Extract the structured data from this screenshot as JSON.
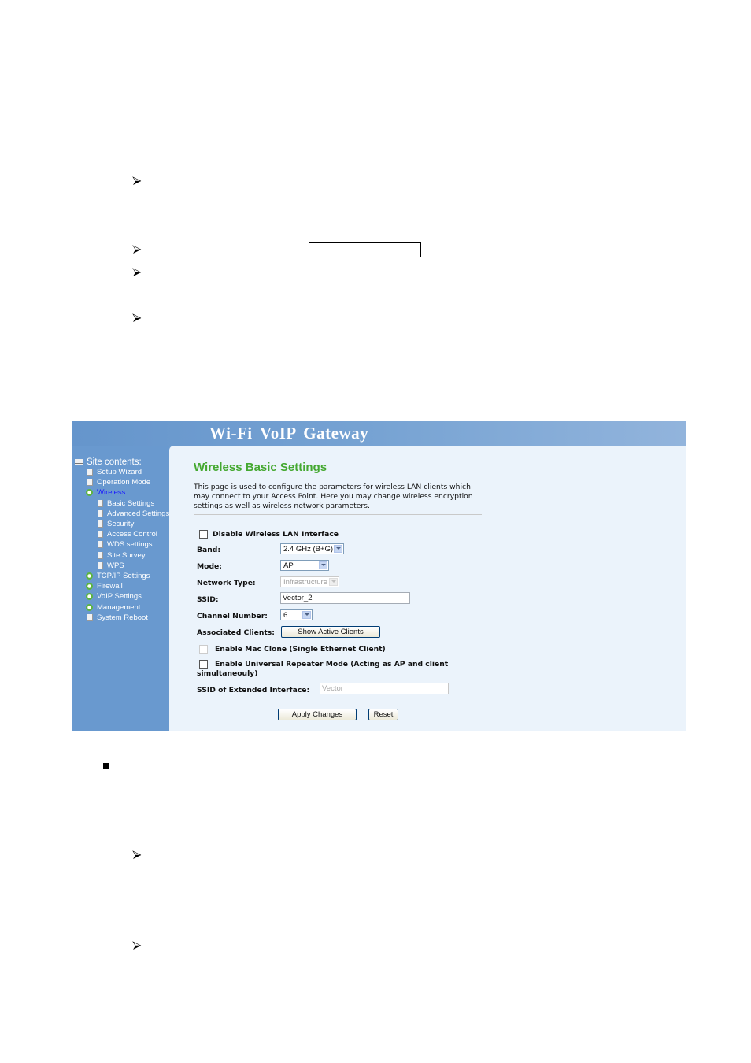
{
  "document": {
    "arrow_bullets": 6,
    "square_bullets": 1,
    "inline_box_text": ""
  },
  "app": {
    "banner_title": "Wi-Fi  VoIP  Gateway"
  },
  "sidebar": {
    "heading": "Site contents:",
    "items": [
      {
        "label": "Setup Wizard",
        "icon": "page-icon",
        "level": 0
      },
      {
        "label": "Operation Mode",
        "icon": "page-icon",
        "level": 0
      },
      {
        "label": "Wireless",
        "icon": "folder-open-icon",
        "level": 0,
        "active": true
      },
      {
        "label": "Basic Settings",
        "icon": "page-icon",
        "level": 1
      },
      {
        "label": "Advanced Settings",
        "icon": "page-icon",
        "level": 1
      },
      {
        "label": "Security",
        "icon": "page-icon",
        "level": 1
      },
      {
        "label": "Access Control",
        "icon": "page-icon",
        "level": 1
      },
      {
        "label": "WDS settings",
        "icon": "page-icon",
        "level": 1
      },
      {
        "label": "Site Survey",
        "icon": "page-icon",
        "level": 1
      },
      {
        "label": "WPS",
        "icon": "page-icon",
        "level": 1
      },
      {
        "label": "TCP/IP Settings",
        "icon": "folder-icon",
        "level": 0
      },
      {
        "label": "Firewall",
        "icon": "folder-icon",
        "level": 0
      },
      {
        "label": "VoIP Settings",
        "icon": "folder-icon",
        "level": 0
      },
      {
        "label": "Management",
        "icon": "folder-icon",
        "level": 0
      },
      {
        "label": "System Reboot",
        "icon": "page-icon",
        "level": 0
      }
    ]
  },
  "main": {
    "title": "Wireless Basic Settings",
    "description": "This page is used to configure the parameters for wireless LAN clients which may connect to your Access Point. Here you may change wireless encryption settings as well as wireless network parameters.",
    "disable_wlan": {
      "label": "Disable Wireless LAN Interface",
      "checked": false
    },
    "band": {
      "label": "Band:",
      "value": "2.4 GHz (B+G)"
    },
    "mode": {
      "label": "Mode:",
      "value": "AP"
    },
    "network_type": {
      "label": "Network Type:",
      "value": "Infrastructure",
      "disabled": true
    },
    "ssid": {
      "label": "SSID:",
      "value": "Vector_2"
    },
    "channel": {
      "label": "Channel Number:",
      "value": "6"
    },
    "associated_clients": {
      "label": "Associated Clients:",
      "button": "Show Active Clients"
    },
    "mac_clone": {
      "label": "Enable Mac Clone (Single Ethernet Client)",
      "checked": false,
      "disabled": true
    },
    "repeater": {
      "label_line1": "Enable Universal Repeater Mode (Acting as AP and client",
      "label_line2": "simultaneouly)",
      "checked": false
    },
    "ext_ssid": {
      "label": "SSID of Extended Interface:",
      "value": "Vector",
      "disabled": true
    },
    "apply_button": "Apply Changes",
    "reset_button": "Reset"
  }
}
